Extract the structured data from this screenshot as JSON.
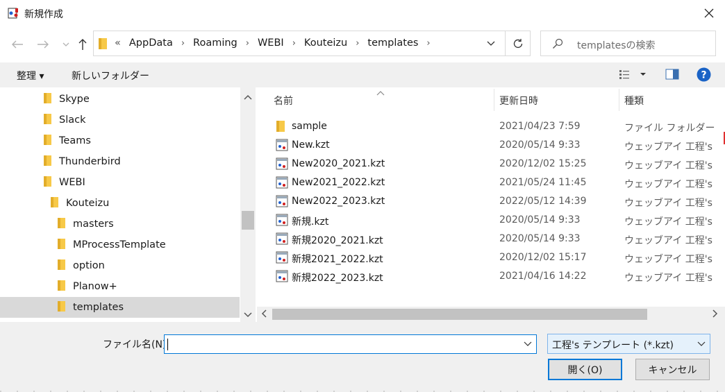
{
  "window": {
    "title": "新規作成"
  },
  "address": {
    "overflow": "«",
    "crumbs": [
      "AppData",
      "Roaming",
      "WEBI",
      "Kouteizu",
      "templates"
    ]
  },
  "search": {
    "placeholder": "templatesの検索"
  },
  "toolbar": {
    "organize": "整理 ▾",
    "new_folder": "新しいフォルダー"
  },
  "tree": {
    "items": [
      {
        "label": "Skype",
        "level": 0
      },
      {
        "label": "Slack",
        "level": 0
      },
      {
        "label": "Teams",
        "level": 0
      },
      {
        "label": "Thunderbird",
        "level": 0
      },
      {
        "label": "WEBI",
        "level": 0
      },
      {
        "label": "Kouteizu",
        "level": 1
      },
      {
        "label": "masters",
        "level": 2
      },
      {
        "label": "MProcessTemplate",
        "level": 2
      },
      {
        "label": "option",
        "level": 2
      },
      {
        "label": "Planow+",
        "level": 2
      },
      {
        "label": "templates",
        "level": 2
      }
    ],
    "selected": "templates"
  },
  "columns": {
    "name": "名前",
    "date": "更新日時",
    "type": "種類"
  },
  "files": [
    {
      "name": "sample",
      "date": "2021/04/23 7:59",
      "type": "ファイル フォルダー",
      "kind": "folder"
    },
    {
      "name": "New.kzt",
      "date": "2020/05/14 9:33",
      "type": "ウェッブアイ 工程's",
      "kind": "kzt"
    },
    {
      "name": "New2020_2021.kzt",
      "date": "2020/12/02 15:25",
      "type": "ウェッブアイ 工程's",
      "kind": "kzt"
    },
    {
      "name": "New2021_2022.kzt",
      "date": "2021/05/24 11:45",
      "type": "ウェッブアイ 工程's",
      "kind": "kzt"
    },
    {
      "name": "New2022_2023.kzt",
      "date": "2022/05/12 14:39",
      "type": "ウェッブアイ 工程's",
      "kind": "kzt"
    },
    {
      "name": "新規.kzt",
      "date": "2020/05/14 9:33",
      "type": "ウェッブアイ 工程's",
      "kind": "kzt"
    },
    {
      "name": "新規2020_2021.kzt",
      "date": "2020/05/14 9:33",
      "type": "ウェッブアイ 工程's",
      "kind": "kzt"
    },
    {
      "name": "新規2021_2022.kzt",
      "date": "2020/12/02 15:17",
      "type": "ウェッブアイ 工程's",
      "kind": "kzt"
    },
    {
      "name": "新規2022_2023.kzt",
      "date": "2021/04/16 14:22",
      "type": "ウェッブアイ 工程's",
      "kind": "kzt"
    }
  ],
  "filename": {
    "label": "ファイル名(N):",
    "value": ""
  },
  "filetype": {
    "selected": "工程's テンプレート (*.kzt)"
  },
  "buttons": {
    "open": "開く(O)",
    "cancel": "キャンセル"
  },
  "colors": {
    "accent": "#0078d7",
    "folder": "#f7c948",
    "selection": "#d9d9d9"
  }
}
